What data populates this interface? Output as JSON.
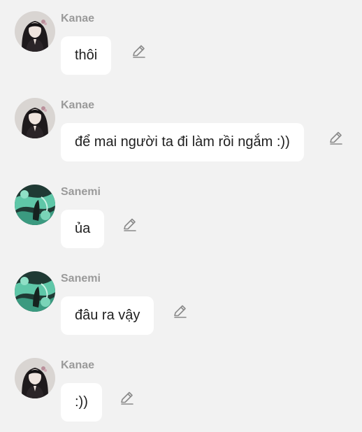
{
  "messages": [
    {
      "sender": "Kanae",
      "text": "thôi",
      "avatar": "kanae-avatar"
    },
    {
      "sender": "Kanae",
      "text": "để mai người ta đi làm rồi ngắm :))",
      "avatar": "kanae-avatar"
    },
    {
      "sender": "Sanemi",
      "text": "ủa",
      "avatar": "sanemi-avatar"
    },
    {
      "sender": "Sanemi",
      "text": "đâu ra vậy",
      "avatar": "sanemi-avatar"
    },
    {
      "sender": "Kanae",
      "text": ":))",
      "avatar": "kanae-avatar"
    }
  ],
  "icons": {
    "edit": "pencil-icon"
  },
  "colors": {
    "background": "#f2f2f2",
    "bubble": "#ffffff",
    "sender_name": "#9a9a9a",
    "message_text": "#1f1f1f",
    "icon": "#8a8a8a"
  }
}
